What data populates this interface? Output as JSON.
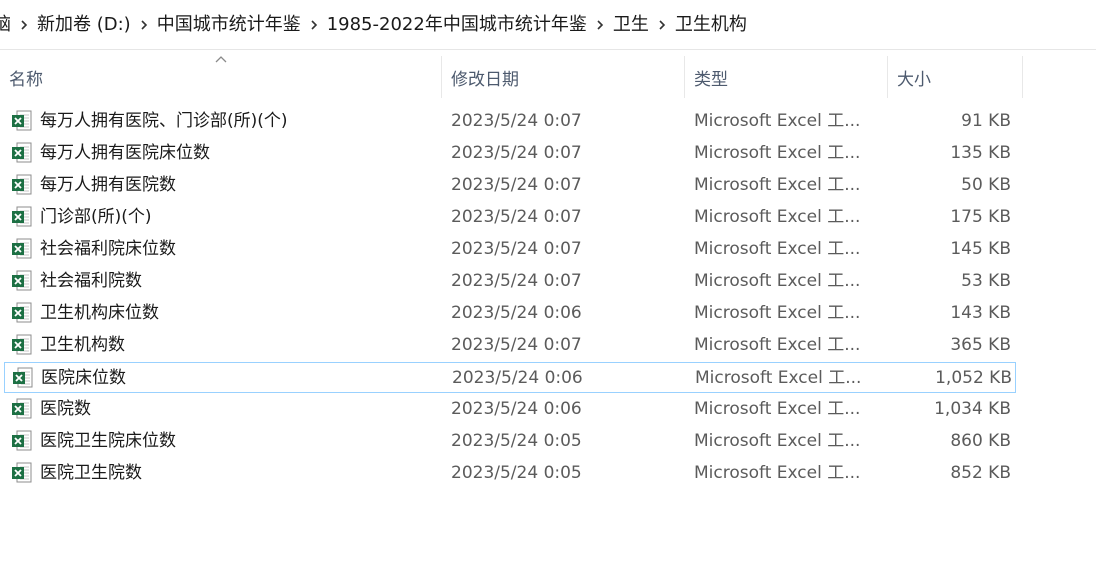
{
  "breadcrumb": {
    "items": [
      "脑",
      "新加卷 (D:)",
      "中国城市统计年鉴",
      "1985-2022年中国城市统计年鉴",
      "卫生",
      "卫生机构"
    ]
  },
  "columns": {
    "name": "名称",
    "date": "修改日期",
    "type": "类型",
    "size": "大小"
  },
  "files": [
    {
      "name": "每万人拥有医院、门诊部(所)(个)",
      "date": "2023/5/24 0:07",
      "type": "Microsoft Excel 工...",
      "size": "91 KB"
    },
    {
      "name": "每万人拥有医院床位数",
      "date": "2023/5/24 0:07",
      "type": "Microsoft Excel 工...",
      "size": "135 KB"
    },
    {
      "name": "每万人拥有医院数",
      "date": "2023/5/24 0:07",
      "type": "Microsoft Excel 工...",
      "size": "50 KB"
    },
    {
      "name": "门诊部(所)(个)",
      "date": "2023/5/24 0:07",
      "type": "Microsoft Excel 工...",
      "size": "175 KB"
    },
    {
      "name": "社会福利院床位数",
      "date": "2023/5/24 0:07",
      "type": "Microsoft Excel 工...",
      "size": "145 KB"
    },
    {
      "name": "社会福利院数",
      "date": "2023/5/24 0:07",
      "type": "Microsoft Excel 工...",
      "size": "53 KB"
    },
    {
      "name": "卫生机构床位数",
      "date": "2023/5/24 0:06",
      "type": "Microsoft Excel 工...",
      "size": "143 KB"
    },
    {
      "name": "卫生机构数",
      "date": "2023/5/24 0:07",
      "type": "Microsoft Excel 工...",
      "size": "365 KB"
    },
    {
      "name": "医院床位数",
      "date": "2023/5/24 0:06",
      "type": "Microsoft Excel 工...",
      "size": "1,052 KB"
    },
    {
      "name": "医院数",
      "date": "2023/5/24 0:06",
      "type": "Microsoft Excel 工...",
      "size": "1,034 KB"
    },
    {
      "name": "医院卫生院床位数",
      "date": "2023/5/24 0:05",
      "type": "Microsoft Excel 工...",
      "size": "860 KB"
    },
    {
      "name": "医院卫生院数",
      "date": "2023/5/24 0:05",
      "type": "Microsoft Excel 工...",
      "size": "852 KB"
    }
  ],
  "selected_index": 8,
  "icons": {
    "separator": "chevron-right-icon",
    "file": "excel-file-icon",
    "sort": "sort-ascending-icon"
  },
  "colors": {
    "excel_green": "#1d7044",
    "selection_border": "#99d1ff",
    "header_text": "#4d5a6e"
  }
}
